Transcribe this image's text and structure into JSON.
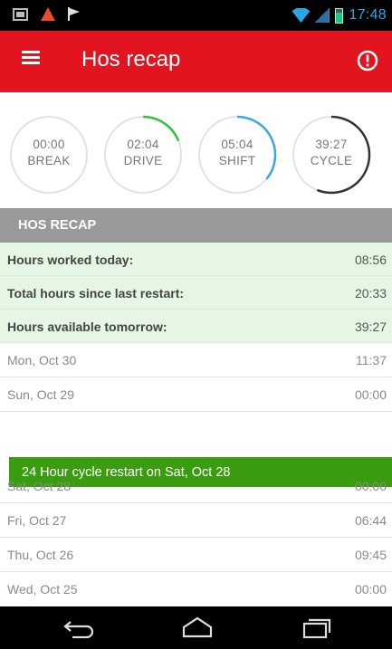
{
  "status_bar": {
    "icons": [
      "message-icon",
      "warning-icon",
      "flag-icon",
      "wifi-icon",
      "signal-icon",
      "battery-icon"
    ],
    "time": "17:48"
  },
  "app_bar": {
    "title": "Hos recap",
    "menu_icon": "menu-icon",
    "alert_icon": "alert-icon",
    "color": "#e2141f"
  },
  "gauges": [
    {
      "time": "00:00",
      "label": "BREAK",
      "progress": 0,
      "color": "#2fc23a"
    },
    {
      "time": "02:04",
      "label": "DRIVE",
      "progress": 0.19,
      "color": "#2fc23a"
    },
    {
      "time": "05:04",
      "label": "SHIFT",
      "progress": 0.36,
      "color": "#3ca6e0"
    },
    {
      "time": "39:27",
      "label": "CYCLE",
      "progress": 0.56,
      "color": "#333333"
    }
  ],
  "section": {
    "title": "HOS RECAP"
  },
  "summary": [
    {
      "label": "Hours worked today:",
      "value": "08:56"
    },
    {
      "label": "Total hours since last restart:",
      "value": "20:33"
    },
    {
      "label": "Hours available tomorrow:",
      "value": "39:27"
    }
  ],
  "days_before": [
    {
      "label": "Mon, Oct 30",
      "value": "11:37"
    },
    {
      "label": "Sun, Oct 29",
      "value": "00:00"
    }
  ],
  "restart_banner": {
    "text": "24 Hour cycle restart on Sat, Oct 28",
    "color": "#3a9d10"
  },
  "days_after": [
    {
      "label": "Sat, Oct 28",
      "value": "00:00"
    },
    {
      "label": "Fri, Oct 27",
      "value": "06:44"
    },
    {
      "label": "Thu, Oct 26",
      "value": "09:45"
    },
    {
      "label": "Wed, Oct 25",
      "value": "00:00"
    }
  ],
  "nav_bar": {
    "buttons": [
      "back-icon",
      "home-icon",
      "recent-apps-icon"
    ]
  }
}
